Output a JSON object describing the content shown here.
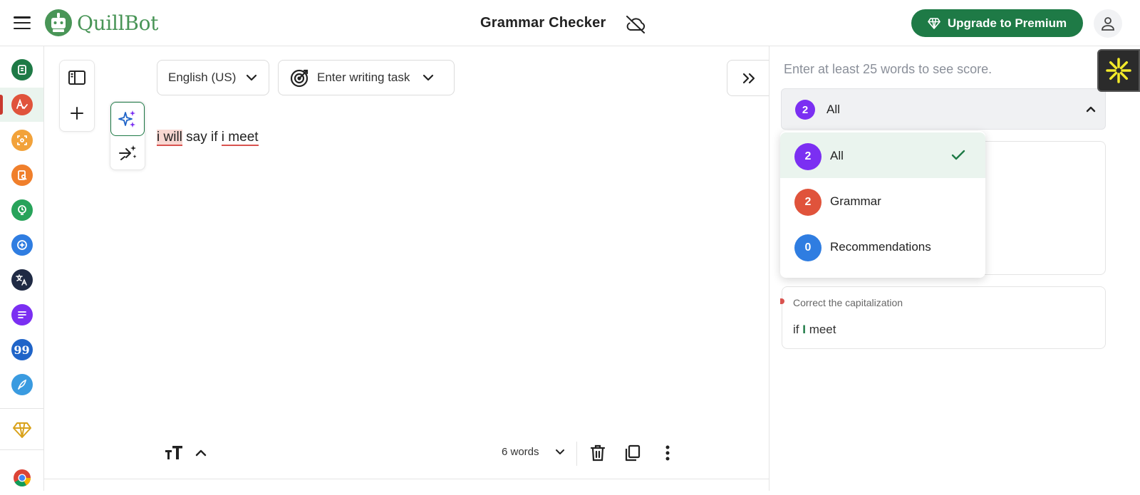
{
  "header": {
    "brand": "QuillBot",
    "title": "Grammar Checker",
    "upgrade_label": "Upgrade to Premium"
  },
  "rail": {
    "items": [
      {
        "name": "paraphraser",
        "color": "#1e7a46",
        "icon": "paraphraser-icon"
      },
      {
        "name": "grammar-checker",
        "color": "#e0533b",
        "icon": "grammar-checker-icon",
        "active": true
      },
      {
        "name": "ai-detector",
        "color": "#f2a23a",
        "icon": "ai-detector-icon"
      },
      {
        "name": "plagiarism-checker",
        "color": "#f07f2b",
        "icon": "plagiarism-checker-icon"
      },
      {
        "name": "ai-humanizer",
        "color": "#27a35a",
        "icon": "ai-humanizer-icon"
      },
      {
        "name": "ai-chat",
        "color": "#2f7de1",
        "icon": "ai-chat-icon"
      },
      {
        "name": "translator",
        "color": "#1f2a44",
        "icon": "translator-icon"
      },
      {
        "name": "summarizer",
        "color": "#7b2ff2",
        "icon": "summarizer-icon"
      },
      {
        "name": "citation-generator",
        "color": "#1f64c8",
        "icon": "citation-icon"
      },
      {
        "name": "ai-writer",
        "color": "#3a9be0",
        "icon": "quill-pen-icon"
      }
    ],
    "premium_icon": "diamond-icon",
    "chrome_icon": "chrome-icon"
  },
  "editor": {
    "language": "English (US)",
    "writing_task": "Enter writing task",
    "text_parts": {
      "err1": "i will",
      "plain": " say if ",
      "err2": "i meet"
    },
    "word_count": "6 words"
  },
  "panel": {
    "score_hint": "Enter at least 25 words to see score.",
    "filter": {
      "count": "2",
      "label": "All"
    },
    "dropdown": [
      {
        "count": "2",
        "label": "All",
        "color": "#7b2ff2",
        "selected": true
      },
      {
        "count": "2",
        "label": "Grammar",
        "color": "#e0533b"
      },
      {
        "count": "0",
        "label": "Recommendations",
        "color": "#2f7de1"
      }
    ],
    "suggestion": {
      "title": "Correct the capitalization",
      "before": "if ",
      "fix": "I",
      "after": " meet"
    }
  },
  "colors": {
    "brand_green": "#1e7a46",
    "error_red": "#d9534f"
  }
}
